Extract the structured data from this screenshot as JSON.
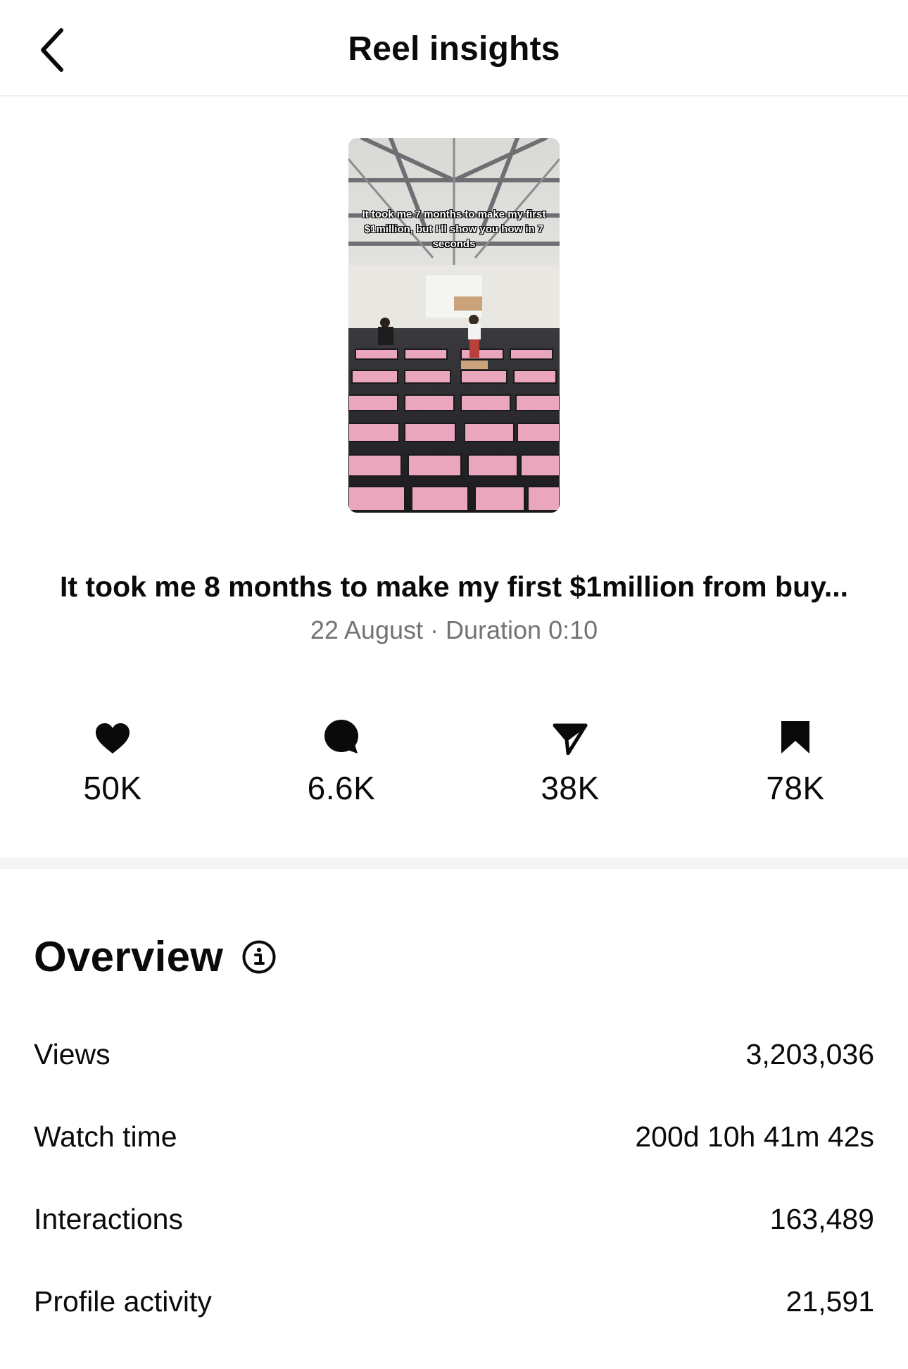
{
  "header": {
    "title": "Reel insights"
  },
  "reel": {
    "thumbnail_caption": "It took me 7 months to make my first $1million, but I'll show you how in 7 seconds",
    "title": "It took me 8 months to make my first $1million from buy...",
    "date_duration": "22 August · Duration 0:10"
  },
  "stats": [
    {
      "icon": "heart-icon",
      "value": "50K"
    },
    {
      "icon": "comment-icon",
      "value": "6.6K"
    },
    {
      "icon": "share-icon",
      "value": "38K"
    },
    {
      "icon": "bookmark-icon",
      "value": "78K"
    }
  ],
  "overview": {
    "title": "Overview",
    "rows": [
      {
        "label": "Views",
        "value": "3,203,036"
      },
      {
        "label": "Watch time",
        "value": "200d 10h 41m 42s"
      },
      {
        "label": "Interactions",
        "value": "163,489"
      },
      {
        "label": "Profile activity",
        "value": "21,591"
      }
    ]
  },
  "colors": {
    "text": "#0a0a0a",
    "muted": "#737373",
    "divider": "#f3f4f6",
    "accent_pink": "#e9a6bd"
  }
}
